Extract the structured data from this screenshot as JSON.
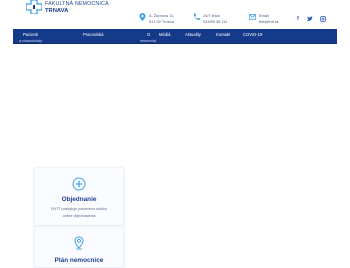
{
  "logo": {
    "line1": "FAKULTNÁ NEMOCNICA",
    "line2": "TRNAVA"
  },
  "contacts": [
    {
      "icon": "location-pin-icon",
      "line1": "A. Žarnova 11,",
      "line2": "917 02 Trnava"
    },
    {
      "icon": "phone-icon",
      "line1": "24/7 linka",
      "line2": "033/59 38 111"
    },
    {
      "icon": "email-icon",
      "line1": "Email",
      "line2": "fntt@fntt.sk"
    }
  ],
  "social": [
    "f",
    "twitter-icon",
    "instagram-icon"
  ],
  "nav": {
    "items": [
      "Pacienti",
      "Pracoviská",
      "O",
      "Médiá",
      "Aktuality",
      "Kontakt",
      "COVID-19"
    ],
    "sub": [
      "a zdravotnícky",
      "nemocnici"
    ]
  },
  "cards": [
    {
      "title": "Objednanie",
      "desc1": "FNTT poskytuje pacientom službu",
      "desc2": "online objednávania",
      "icon": "plus-circle-icon"
    },
    {
      "title": "Plán nemocnice",
      "icon": "map-pin-icon"
    }
  ],
  "colors": {
    "nav_bg": "#163a8a",
    "brand": "#1f3f8f",
    "accent": "#3fa2e0"
  }
}
